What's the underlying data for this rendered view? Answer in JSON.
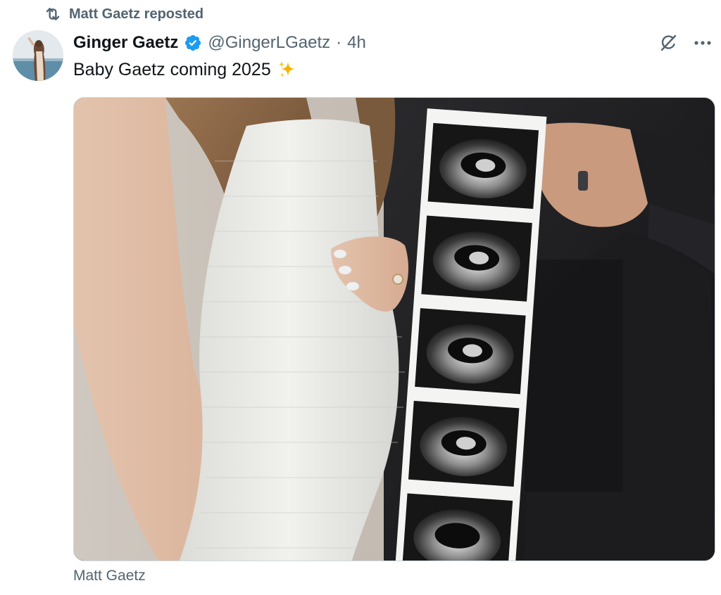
{
  "repost": {
    "icon": "repost-icon",
    "text": "Matt Gaetz reposted"
  },
  "author": {
    "avatar": "avatar",
    "display_name": "Ginger Gaetz",
    "verified_icon": "verified-badge-icon",
    "handle": "@GingerLGaetz",
    "separator": "·",
    "time": "4h"
  },
  "actions": {
    "grok_icon": "grok-icon",
    "more_icon": "more-icon"
  },
  "tweet": {
    "text": "Baby Gaetz coming 2025",
    "emoji_icon": "sparkles-icon"
  },
  "media": {
    "image": "pregnancy-announcement-photo"
  },
  "caption": {
    "text": "Matt Gaetz"
  },
  "colors": {
    "text_primary": "#0f1419",
    "text_secondary": "#536471",
    "verified_blue": "#1d9bf0",
    "border": "#cfd9de",
    "sparkle_gold": "#f4b400"
  }
}
